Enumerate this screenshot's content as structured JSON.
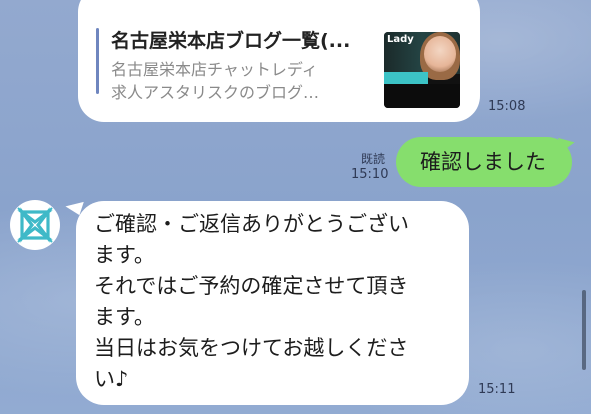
{
  "link_preview": {
    "title": "名古屋栄本店ブログ一覧(...",
    "description_line1": "名古屋栄本店チャットレディ",
    "description_line2": "求人アスタリスクのブログ…",
    "thumbnail_text": "Lady",
    "time": "15:08"
  },
  "sent_message": {
    "read_label": "既読",
    "time": "15:10",
    "text": "確認しました"
  },
  "received_message": {
    "lines": [
      "ご確認・ご返信ありがとうござい",
      "ます。",
      "それではご予約の確定させて頂き",
      "ます。",
      "当日はお気をつけてお越しくださ",
      "い♪"
    ],
    "time": "15:11"
  },
  "colors": {
    "sent_bubble": "#86de6d",
    "received_bubble": "#ffffff",
    "chat_background": "#8ea6cf",
    "avatar_logo": "#3fb9c8",
    "link_accent": "#6f86bf"
  }
}
